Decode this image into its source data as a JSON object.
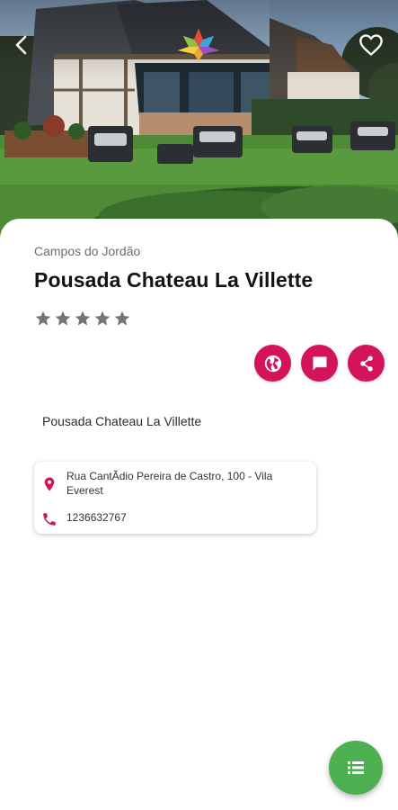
{
  "header": {
    "back_icon": "arrow-back-icon",
    "favorite_icon": "heart-outline-icon",
    "logo_icon": "maple-leaf-logo"
  },
  "hotel": {
    "city": "Campos do Jordão",
    "name": "Pousada Chateau La Villette",
    "rating": 0,
    "rating_max": 5,
    "description": "Pousada Chateau La Villette",
    "address": "Rua CantÃdio Pereira de Castro, 100 - Vila Everest",
    "phone": "1236632767"
  },
  "actions": [
    {
      "name": "website",
      "icon": "globe-icon"
    },
    {
      "name": "message",
      "icon": "chat-icon"
    },
    {
      "name": "share",
      "icon": "share-icon"
    }
  ],
  "fab": {
    "icon": "list-icon"
  },
  "colors": {
    "accent": "#d4145a",
    "fab": "#4caf50",
    "star_empty": "#757575",
    "title": "#121212"
  }
}
